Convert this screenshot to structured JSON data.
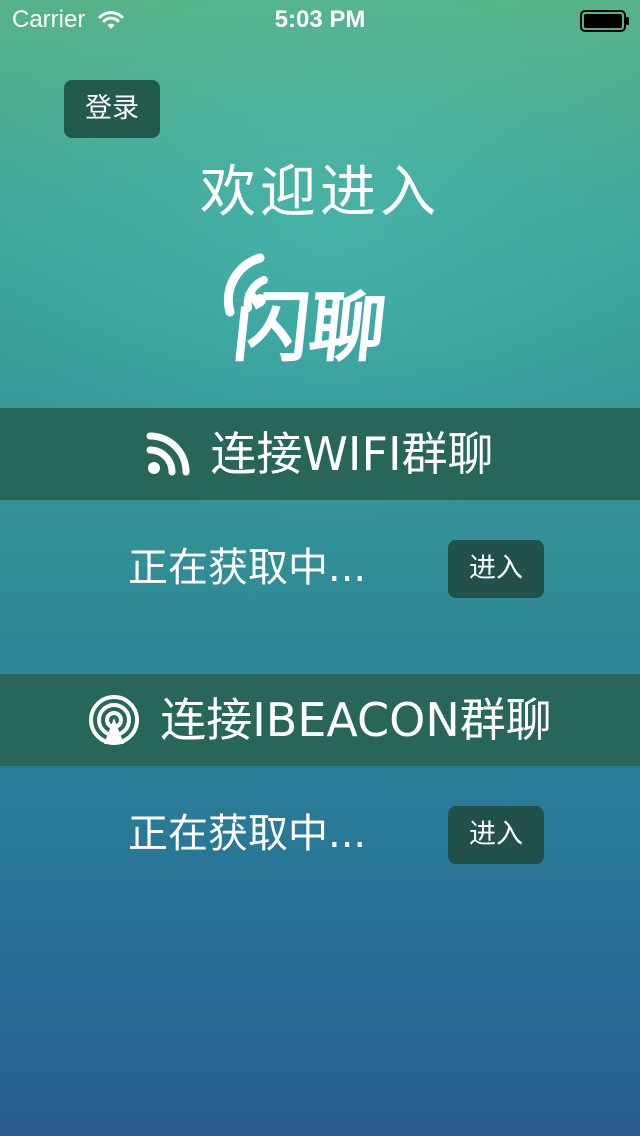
{
  "status_bar": {
    "carrier": "Carrier",
    "time": "5:03 PM",
    "icons": [
      "wifi-signal-icon",
      "battery-icon"
    ]
  },
  "login_button": "登录",
  "welcome_text": "欢迎进入",
  "logo": {
    "text": "闪聊",
    "icon": "signal-waves-icon"
  },
  "wifi_section": {
    "icon": "rss-icon",
    "title": "连接WIFI群聊",
    "status": "正在获取中...",
    "enter_label": "进入"
  },
  "ibeacon_section": {
    "icon": "broadcast-tower-icon",
    "title": "连接IBEACON群聊",
    "status": "正在获取中...",
    "enter_label": "进入"
  },
  "colors": {
    "header_bar": "#276659",
    "button_bg": "#235a4e",
    "gradient_top": "#57b38a",
    "gradient_bottom": "#2a5c8c"
  }
}
